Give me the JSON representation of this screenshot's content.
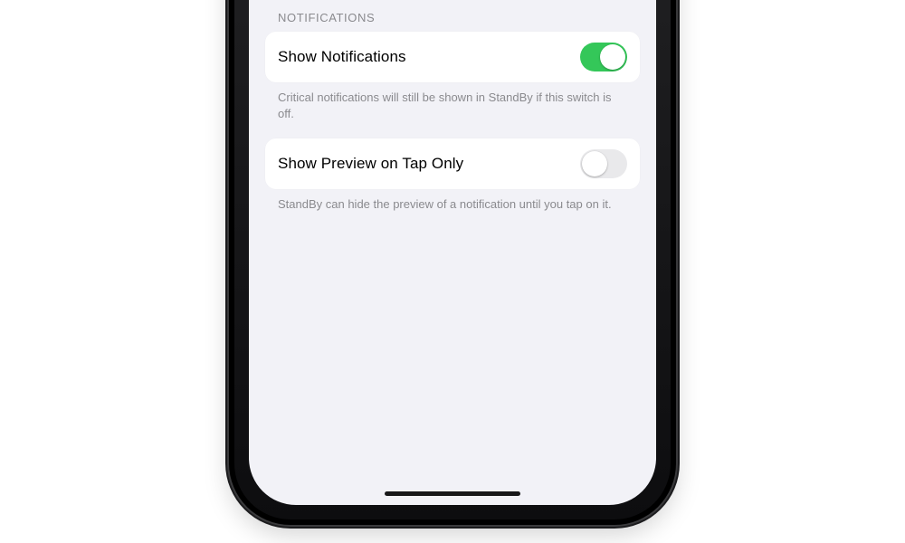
{
  "notifications": {
    "section_header": "NOTIFICATIONS",
    "show_notifications": {
      "label": "Show Notifications",
      "on": true,
      "footer": "Critical notifications will still be shown in StandBy if this switch is off."
    },
    "show_preview_on_tap_only": {
      "label": "Show Preview on Tap Only",
      "on": false,
      "footer": "StandBy can hide the preview of a notification until you tap on it."
    }
  },
  "colors": {
    "switch_on": "#34c759",
    "switch_off": "#e9e9eb",
    "screen_bg": "#f2f2f7"
  }
}
